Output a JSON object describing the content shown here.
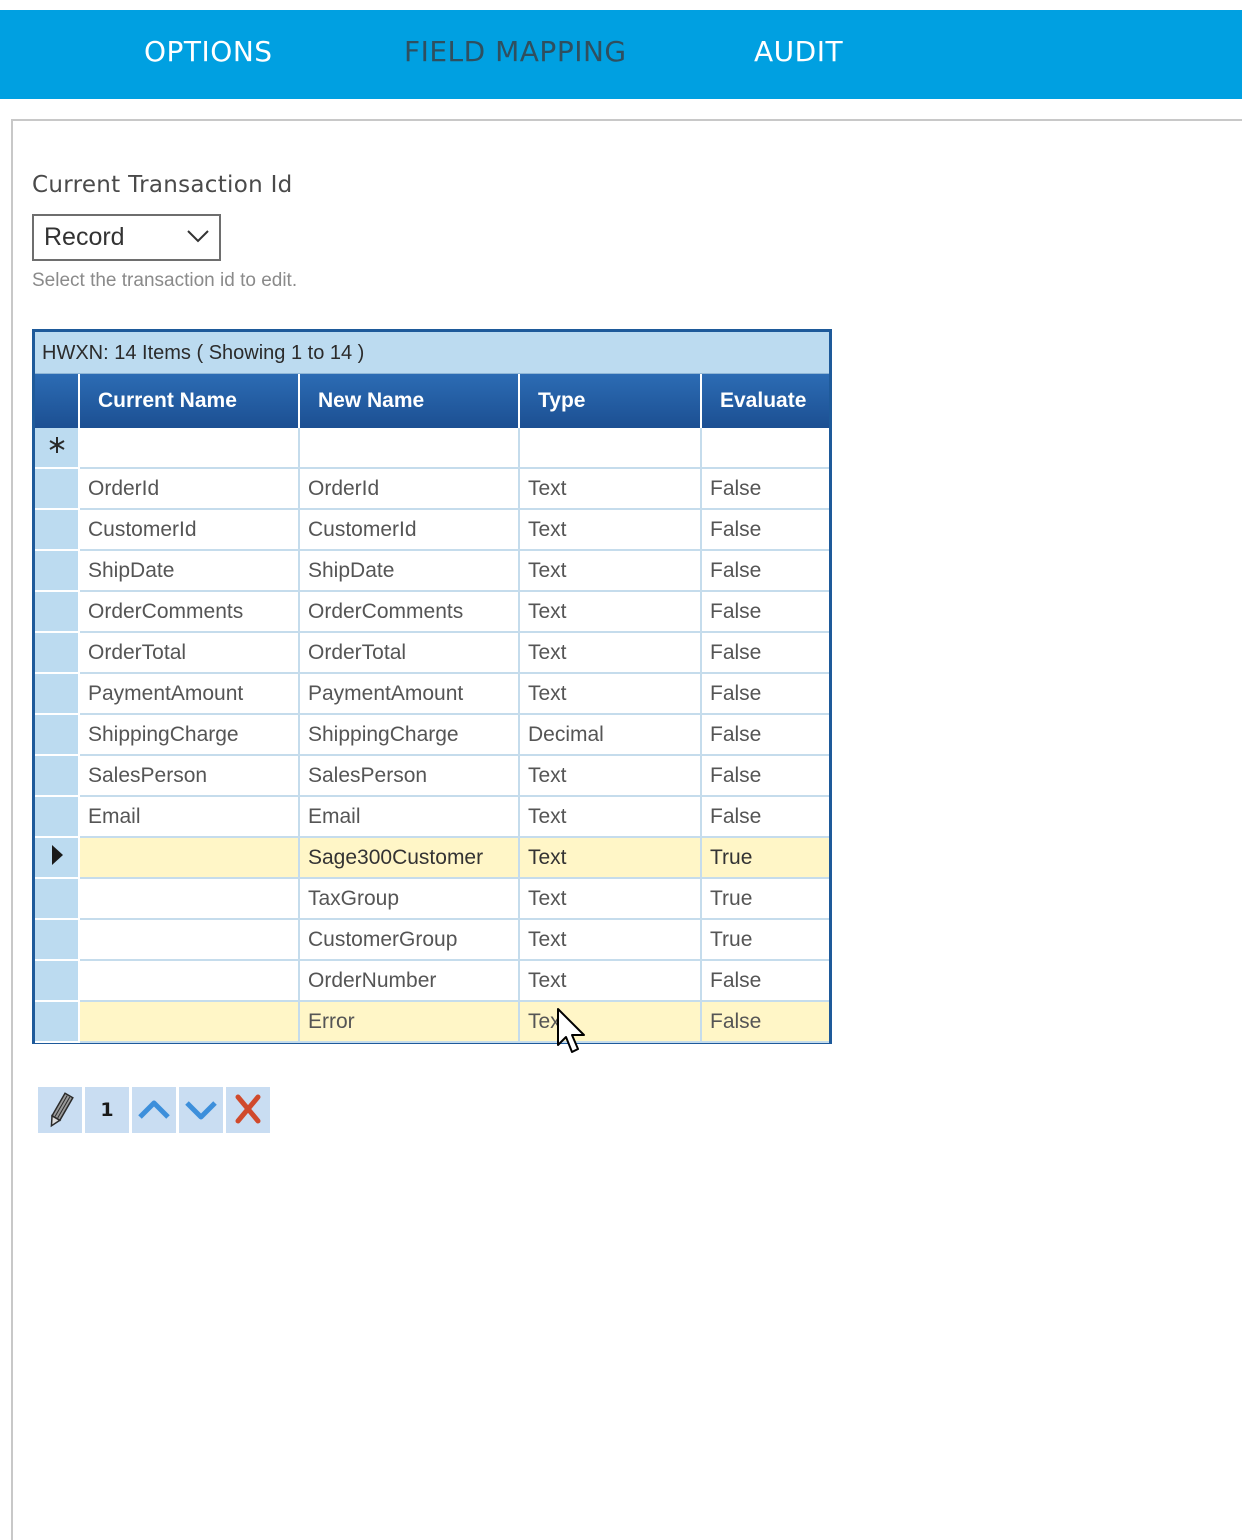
{
  "nav": {
    "tabs": [
      {
        "label": "OPTIONS"
      },
      {
        "label": "FIELD MAPPING"
      },
      {
        "label": "AUDIT"
      }
    ],
    "active_tab": "FIELD MAPPING"
  },
  "transaction": {
    "label": "Current Transaction Id",
    "selected_value": "Record",
    "help_text": "Select the transaction id to edit."
  },
  "grid": {
    "caption": "HWXN: 14 Items ( Showing 1 to 14 )",
    "columns": [
      "Current Name",
      "New Name",
      "Type",
      "Evaluate"
    ],
    "new_row_marker": "asterisk-icon",
    "current_row_marker": "row-pointer-icon",
    "rows": [
      {
        "current_name": "OrderId",
        "new_name": "OrderId",
        "type": "Text",
        "evaluate": "False"
      },
      {
        "current_name": "CustomerId",
        "new_name": "CustomerId",
        "type": "Text",
        "evaluate": "False"
      },
      {
        "current_name": "ShipDate",
        "new_name": "ShipDate",
        "type": "Text",
        "evaluate": "False"
      },
      {
        "current_name": "OrderComments",
        "new_name": "OrderComments",
        "type": "Text",
        "evaluate": "False"
      },
      {
        "current_name": "OrderTotal",
        "new_name": "OrderTotal",
        "type": "Text",
        "evaluate": "False"
      },
      {
        "current_name": "PaymentAmount",
        "new_name": "PaymentAmount",
        "type": "Text",
        "evaluate": "False"
      },
      {
        "current_name": "ShippingCharge",
        "new_name": "ShippingCharge",
        "type": "Decimal",
        "evaluate": "False"
      },
      {
        "current_name": "SalesPerson",
        "new_name": "SalesPerson",
        "type": "Text",
        "evaluate": "False"
      },
      {
        "current_name": "Email",
        "new_name": "Email",
        "type": "Text",
        "evaluate": "False"
      },
      {
        "current_name": "",
        "new_name": "Sage300Customer",
        "type": "Text",
        "evaluate": "True"
      },
      {
        "current_name": "",
        "new_name": "TaxGroup",
        "type": "Text",
        "evaluate": "True"
      },
      {
        "current_name": "",
        "new_name": "CustomerGroup",
        "type": "Text",
        "evaluate": "True"
      },
      {
        "current_name": "",
        "new_name": "OrderNumber",
        "type": "Text",
        "evaluate": "False"
      },
      {
        "current_name": "",
        "new_name": "Error",
        "type": "Text",
        "evaluate": "False"
      }
    ]
  },
  "toolbar": {
    "edit_icon": "pencil-icon",
    "page_number": "1",
    "up_icon": "chevron-up-icon",
    "down_icon": "chevron-down-icon",
    "delete_icon": "close-icon"
  },
  "colors": {
    "topbar": "#00a0e1",
    "grid_header": "#1c4f92",
    "selector_column": "#bcdbf0",
    "highlight_row": "#fff6c7",
    "delete": "#d04a2c"
  }
}
